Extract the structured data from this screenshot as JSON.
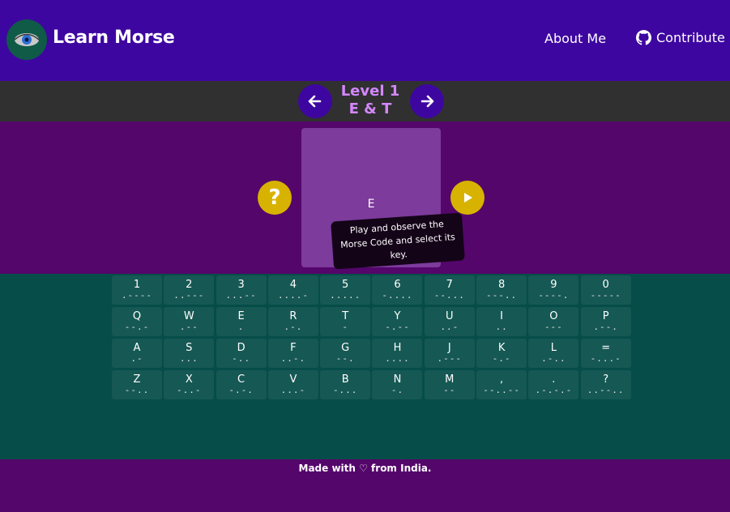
{
  "header": {
    "brand": "Learn Morse",
    "nav": {
      "about": "About Me",
      "contribute": "Contribute"
    }
  },
  "level": {
    "title": "Level 1",
    "letters": "E & T",
    "prev_icon": "arrow-left-icon",
    "next_icon": "arrow-right-icon"
  },
  "practice": {
    "current_letter": "E",
    "help_icon": "question-mark-icon",
    "play_icon": "play-icon",
    "tooltip": "Play and observe the Morse Code and select its key."
  },
  "keyboard": {
    "keys": [
      {
        "char": "1",
        "code": ".----"
      },
      {
        "char": "2",
        "code": "..---"
      },
      {
        "char": "3",
        "code": "...--"
      },
      {
        "char": "4",
        "code": "....-"
      },
      {
        "char": "5",
        "code": "....."
      },
      {
        "char": "6",
        "code": "-...."
      },
      {
        "char": "7",
        "code": "--..."
      },
      {
        "char": "8",
        "code": "---.."
      },
      {
        "char": "9",
        "code": "----."
      },
      {
        "char": "0",
        "code": "-----"
      },
      {
        "char": "Q",
        "code": "--.-"
      },
      {
        "char": "W",
        "code": ".--"
      },
      {
        "char": "E",
        "code": "."
      },
      {
        "char": "R",
        "code": ".-."
      },
      {
        "char": "T",
        "code": "-"
      },
      {
        "char": "Y",
        "code": "-.--"
      },
      {
        "char": "U",
        "code": "..-"
      },
      {
        "char": "I",
        "code": ".."
      },
      {
        "char": "O",
        "code": "---"
      },
      {
        "char": "P",
        "code": ".--."
      },
      {
        "char": "A",
        "code": ".-"
      },
      {
        "char": "S",
        "code": "..."
      },
      {
        "char": "D",
        "code": "-.."
      },
      {
        "char": "F",
        "code": "..-."
      },
      {
        "char": "G",
        "code": "--."
      },
      {
        "char": "H",
        "code": "...."
      },
      {
        "char": "J",
        "code": ".---"
      },
      {
        "char": "K",
        "code": "-.-"
      },
      {
        "char": "L",
        "code": ".-.."
      },
      {
        "char": "=",
        "code": "-...-"
      },
      {
        "char": "Z",
        "code": "--.."
      },
      {
        "char": "X",
        "code": "-..-"
      },
      {
        "char": "C",
        "code": "-.-."
      },
      {
        "char": "V",
        "code": "...-"
      },
      {
        "char": "B",
        "code": "-..."
      },
      {
        "char": "N",
        "code": "-."
      },
      {
        "char": "M",
        "code": "--"
      },
      {
        "char": ",",
        "code": "--..--"
      },
      {
        "char": ".",
        "code": ".-.-.-"
      },
      {
        "char": "?",
        "code": "..--.."
      }
    ]
  },
  "footer": {
    "text": "Made with ♡ from India."
  },
  "colors": {
    "header_bg": "#3e06a0",
    "level_bar_bg": "#303030",
    "level_text": "#d487ff",
    "play_area_bg": "#54066b",
    "card_bg": "#7d3b9c",
    "accent_yellow": "#d8b200",
    "keyboard_bg": "#064d4a",
    "key_bg": "#165854"
  }
}
